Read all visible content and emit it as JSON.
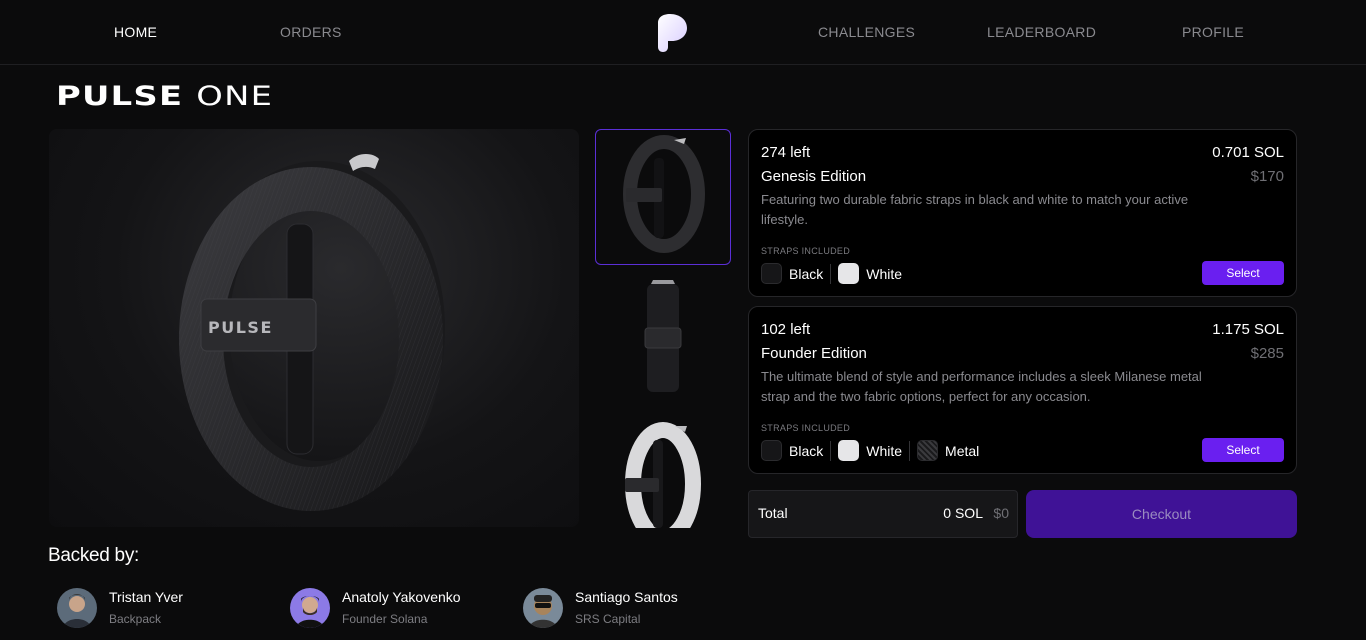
{
  "nav": {
    "items": [
      {
        "label": "HOME",
        "active": true
      },
      {
        "label": "ORDERS",
        "active": false
      },
      {
        "label": "CHALLENGES",
        "active": false
      },
      {
        "label": "LEADERBOARD",
        "active": false
      },
      {
        "label": "PROFILE",
        "active": false
      }
    ]
  },
  "product": {
    "title_bold": "PULSE",
    "title_light": "ONE",
    "device_label": "PULSE"
  },
  "editions": [
    {
      "left": "274 left",
      "name": "Genesis Edition",
      "price_sol": "0.701 SOL",
      "price_usd": "$170",
      "description": "Featuring two durable fabric straps in black and white to match your active lifestyle.",
      "straps_label": "STRAPS INCLUDED",
      "straps": [
        "Black",
        "White"
      ],
      "select_label": "Select"
    },
    {
      "left": "102 left",
      "name": "Founder Edition",
      "price_sol": "1.175 SOL",
      "price_usd": "$285",
      "description": "The ultimate blend of style and performance includes a sleek Milanese metal strap and the two fabric options, perfect for any occasion.",
      "straps_label": "STRAPS INCLUDED",
      "straps": [
        "Black",
        "White",
        "Metal"
      ],
      "select_label": "Select"
    }
  ],
  "total": {
    "label": "Total",
    "sol": "0 SOL",
    "usd": "$0",
    "checkout_label": "Checkout"
  },
  "backed_by": {
    "title": "Backed by:",
    "backers": [
      {
        "name": "Tristan Yver",
        "org": "Backpack"
      },
      {
        "name": "Anatoly Yakovenko",
        "org": "Founder Solana"
      },
      {
        "name": "Santiago Santos",
        "org": "SRS Capital"
      }
    ]
  },
  "colors": {
    "accent": "#6a1ff0",
    "checkout_bg": "#3f1296",
    "background": "#0b0b0c"
  }
}
